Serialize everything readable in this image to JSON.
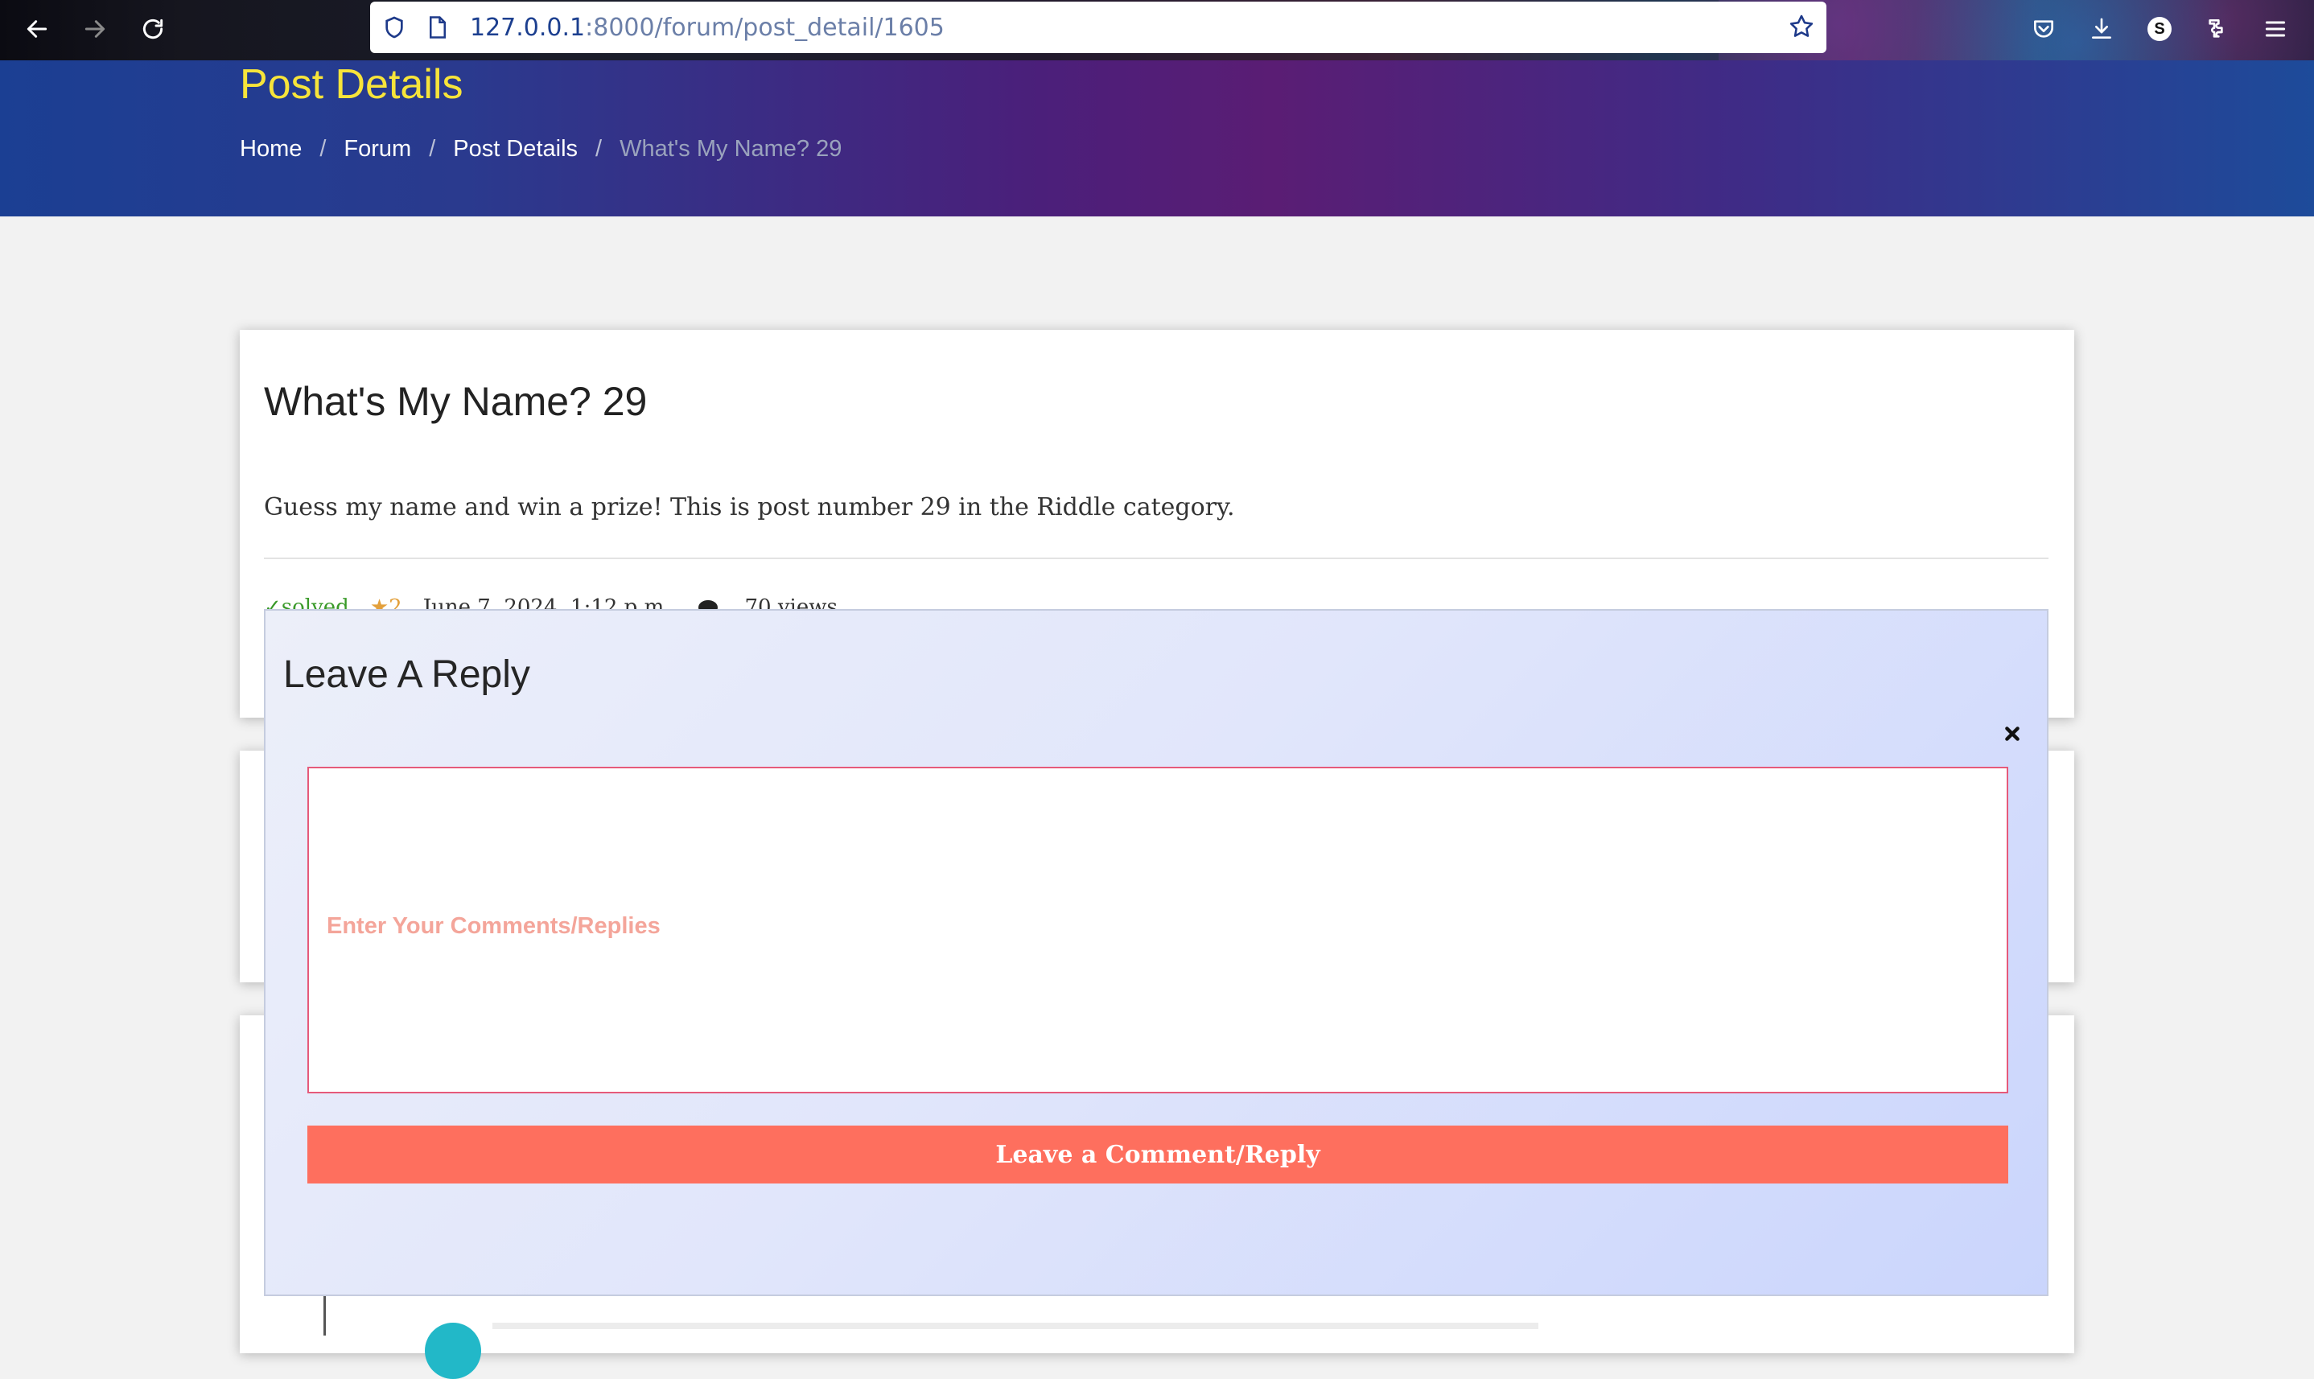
{
  "browser": {
    "url_host": "127.0.0.1",
    "url_rest": ":8000/forum/post_detail/1605",
    "profile_initial": "S"
  },
  "hero": {
    "title": "Post Details",
    "breadcrumb": [
      "Home",
      "Forum",
      "Post Details",
      "What's My Name? 29"
    ]
  },
  "post": {
    "title": "What's My Name? 29",
    "body": "Guess my name and win a prize! This is post number 29 in the Riddle category.",
    "status": "✓solved",
    "rating": "★2",
    "date": "June 7, 2024, 1:12 p.m.",
    "views": "70 views"
  },
  "modal": {
    "title": "Leave A Reply",
    "textarea_placeholder": "Enter Your Comments/Replies",
    "submit_label": "Leave a Comment/Reply"
  },
  "colors": {
    "hero_title": "#f7e43a",
    "submit_button": "#fe6f5e",
    "textarea_border": "#e65a7a",
    "placeholder": "#f4a59a"
  }
}
